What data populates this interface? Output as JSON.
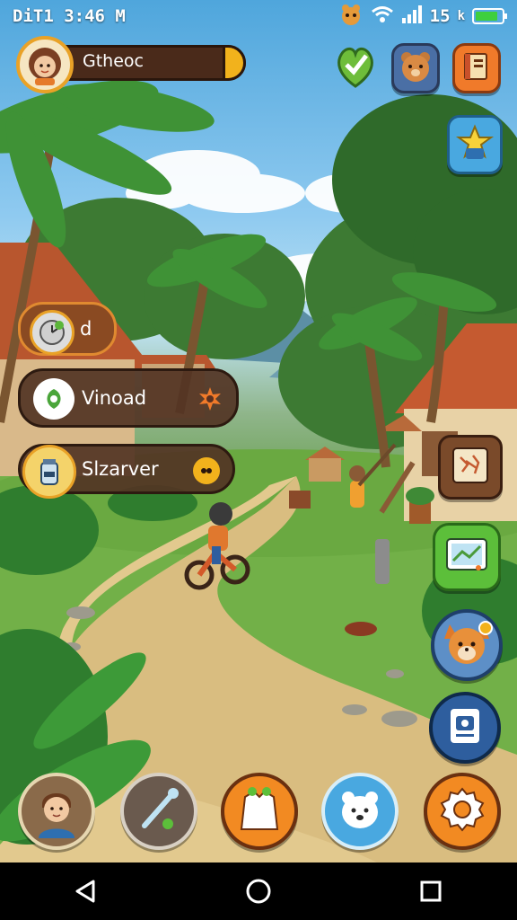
{
  "status_bar": {
    "carrier_time": "DiT1 3:46 M",
    "signal_text": "15",
    "signal_suffix": "k",
    "battery_level": 0.85,
    "battery_color": "#3ecf3e"
  },
  "profile": {
    "name": "Gtheoc",
    "avatar_icon": "girl-avatar-icon"
  },
  "menu": {
    "items": [
      {
        "label": "d",
        "icon": "clock-icon"
      },
      {
        "label": "Vinoad",
        "icon": "leaf-icon",
        "right_icon": "gear-burst-icon"
      },
      {
        "label": "Slzarver",
        "icon": "jar-icon",
        "right_icon": "dots-icon"
      }
    ]
  },
  "top_right_buttons": [
    {
      "icon": "heart-check-icon",
      "color": "#6ebd3a"
    },
    {
      "icon": "bear-icon",
      "color": "#4a6fa5"
    },
    {
      "icon": "book-icon",
      "color": "#f07a2a"
    },
    {
      "icon": "star-shield-icon",
      "color": "#49a8e0"
    }
  ],
  "side_buttons": [
    {
      "icon": "map-pattern-icon"
    },
    {
      "icon": "tablet-map-icon"
    },
    {
      "icon": "fox-avatar-icon"
    },
    {
      "icon": "photo-icon"
    }
  ],
  "bottom_bar": [
    {
      "icon": "boy-avatar-icon"
    },
    {
      "icon": "wand-icon"
    },
    {
      "icon": "shirt-icon"
    },
    {
      "icon": "polar-bear-icon"
    },
    {
      "icon": "settings-gear-icon"
    }
  ],
  "nav_bar": [
    "back-icon",
    "home-icon",
    "recents-icon"
  ],
  "colors": {
    "pill_bg": "#523424",
    "accent_orange": "#f2b21c",
    "sky": "#4fa6dc"
  }
}
